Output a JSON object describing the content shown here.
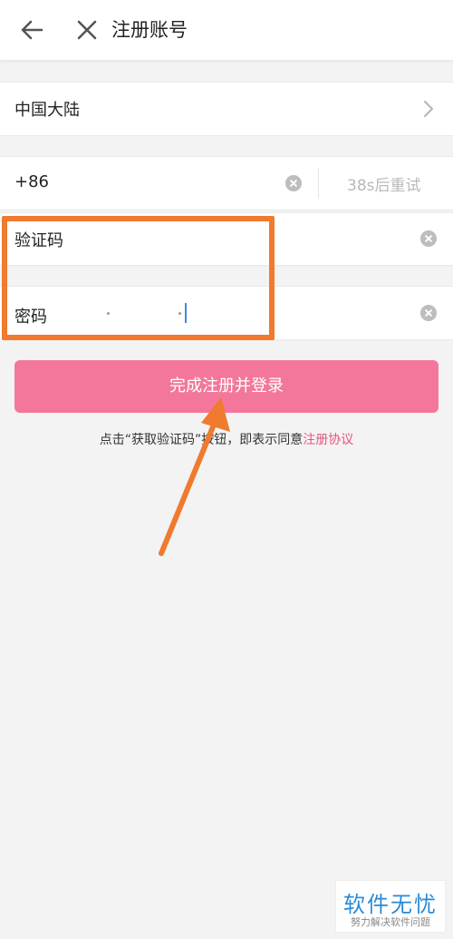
{
  "header": {
    "title": "注册账号",
    "back_icon": "arrow-left-icon",
    "close_icon": "close-icon"
  },
  "region": {
    "label": "中国大陆",
    "chevron_icon": "chevron-right-icon"
  },
  "phone": {
    "country_code": "+86",
    "retry_label": "38s后重试",
    "clear_icon": "clear-icon"
  },
  "code": {
    "label": "验证码",
    "clear_icon": "clear-icon"
  },
  "password": {
    "label": "密码",
    "clear_icon": "clear-icon"
  },
  "submit": {
    "label": "完成注册并登录"
  },
  "agreement": {
    "text": "点击“获取验证码”按钮，即表示同意",
    "link": "注册协议"
  },
  "watermark": {
    "title": "软件无忧",
    "subtitle": "努力解决软件问题"
  },
  "colors": {
    "accent": "#f3779b",
    "annotation": "#f07a2e",
    "link": "#e5557f",
    "cursor": "#3b8ae0"
  }
}
